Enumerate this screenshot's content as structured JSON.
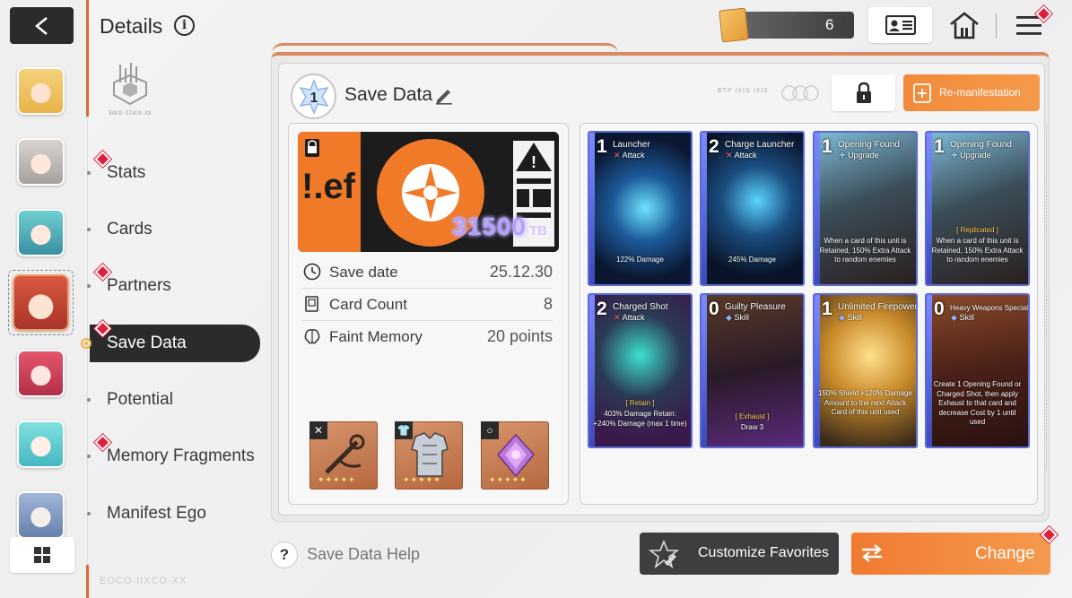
{
  "header": {
    "title": "Details",
    "info_icon": "i",
    "currency_value": "6"
  },
  "sidebar_logo_text": "EOCO-IIXCO-XX",
  "nav": {
    "items": [
      {
        "label": "Stats",
        "badge": true
      },
      {
        "label": "Cards",
        "badge": false
      },
      {
        "label": "Partners",
        "badge": true
      },
      {
        "label": "Save Data",
        "badge": true,
        "active": true
      },
      {
        "label": "Potential",
        "badge": false
      },
      {
        "label": "Memory Fragments",
        "badge": true
      },
      {
        "label": "Manifest Ego",
        "badge": false
      }
    ]
  },
  "save": {
    "slot_number": "1",
    "title": "Save Data",
    "remanifest_label": "Re-manifestation",
    "brand_mark": "BTP IXIS IXIX",
    "tb_value": "31500",
    "tb_unit": "TB",
    "stats": [
      {
        "label": "Save date",
        "value": "25.12.30",
        "icon": "clock-icon"
      },
      {
        "label": "Card Count",
        "value": "8",
        "icon": "card-icon"
      },
      {
        "label": "Faint Memory",
        "value": "20 points",
        "icon": "brain-icon"
      }
    ],
    "equipment": [
      {
        "icon": "weapon-icon",
        "tag": "✕"
      },
      {
        "icon": "armor-icon",
        "tag": "👕"
      },
      {
        "icon": "ring-icon",
        "tag": "○"
      }
    ]
  },
  "cards": [
    {
      "cost": "1",
      "name": "Launcher",
      "type": "Attack",
      "desc": "122% Damage",
      "theme": "blue"
    },
    {
      "cost": "2",
      "name": "Charge Launcher",
      "type": "Attack",
      "desc": "245% Damage",
      "theme": "blue"
    },
    {
      "cost": "1",
      "name": "Opening Found",
      "type": "Upgrade",
      "desc": "When a card of this unit is Retained, 150% Extra Attack to random enemies",
      "theme": "mech"
    },
    {
      "cost": "1",
      "name": "Opening Found",
      "type": "Upgrade",
      "tag": "[ Replicated ]",
      "desc": "When a card of this unit is Retained, 150% Extra Attack to random enemies",
      "theme": "mech"
    },
    {
      "cost": "2",
      "name": "Charged Shot",
      "type": "Attack",
      "tag": "[ Retain ]",
      "desc": "403% Damage Retain: +240% Damage (max 1 time)",
      "theme": "purple"
    },
    {
      "cost": "0",
      "name": "Guilty Pleasure",
      "type": "Skill",
      "tag": "[ Exhaust ]",
      "desc": "Draw 3",
      "theme": "dark"
    },
    {
      "cost": "1",
      "name": "Unlimited Firepower",
      "type": "Skill",
      "desc": "150% Shield +120% Damage Amount to the next Attack Card of this unit used",
      "theme": "gold"
    },
    {
      "cost": "0",
      "name": "Heavy Weapons Specialist",
      "type": "Skill",
      "desc": "Create 1 Opening Found or Charged Shot, then apply Exhaust to that card and decrease Cost by 1 until used",
      "theme": "red"
    }
  ],
  "bottom": {
    "help_icon": "?",
    "help_label": "Save Data Help",
    "favorites_label": "Customize Favorites",
    "change_label": "Change",
    "watermark": "EOCO-IIXCO-XX"
  },
  "colors": {
    "accent": "#f08a3c",
    "dark": "#2b2b2d",
    "badge": "#e0203a"
  }
}
